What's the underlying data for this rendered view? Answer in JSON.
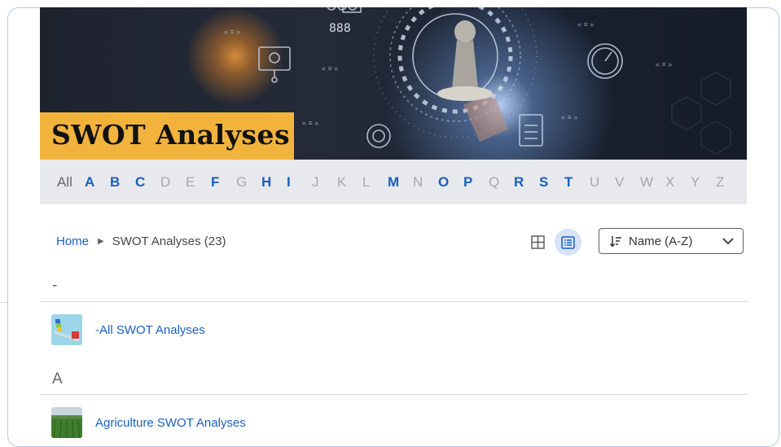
{
  "banner": {
    "title": "SWOT Analyses"
  },
  "alphabet": {
    "all_label": "All",
    "letters": [
      {
        "l": "A",
        "on": true
      },
      {
        "l": "B",
        "on": true
      },
      {
        "l": "C",
        "on": true
      },
      {
        "l": "D",
        "on": false
      },
      {
        "l": "E",
        "on": false
      },
      {
        "l": "F",
        "on": true
      },
      {
        "l": "G",
        "on": false
      },
      {
        "l": "H",
        "on": true
      },
      {
        "l": "I",
        "on": true
      },
      {
        "l": "J",
        "on": false
      },
      {
        "l": "K",
        "on": false
      },
      {
        "l": "L",
        "on": false
      },
      {
        "l": "M",
        "on": true
      },
      {
        "l": "N",
        "on": false
      },
      {
        "l": "O",
        "on": true
      },
      {
        "l": "P",
        "on": true
      },
      {
        "l": "Q",
        "on": false
      },
      {
        "l": "R",
        "on": true
      },
      {
        "l": "S",
        "on": true
      },
      {
        "l": "T",
        "on": true
      },
      {
        "l": "U",
        "on": false
      },
      {
        "l": "V",
        "on": false
      },
      {
        "l": "W",
        "on": false
      },
      {
        "l": "X",
        "on": false
      },
      {
        "l": "Y",
        "on": false
      },
      {
        "l": "Z",
        "on": false
      }
    ]
  },
  "breadcrumb": {
    "home": "Home",
    "current": "SWOT Analyses (23)"
  },
  "toolbar": {
    "grid_icon": "grid-view-icon",
    "list_icon": "list-view-icon",
    "sort_icon": "sort-icon",
    "sort_label": "Name (A-Z)"
  },
  "sections": [
    {
      "heading": "-",
      "items": [
        {
          "label": "-All SWOT Analyses",
          "thumb": "seesaw-icon"
        }
      ]
    },
    {
      "heading": "A",
      "items": [
        {
          "label": "Agriculture SWOT Analyses",
          "thumb": "field-photo"
        }
      ]
    }
  ],
  "colors": {
    "accent": "#1b5fbf",
    "title_bg": "#f2b33d",
    "alpha_bg": "#e7e9ec"
  }
}
